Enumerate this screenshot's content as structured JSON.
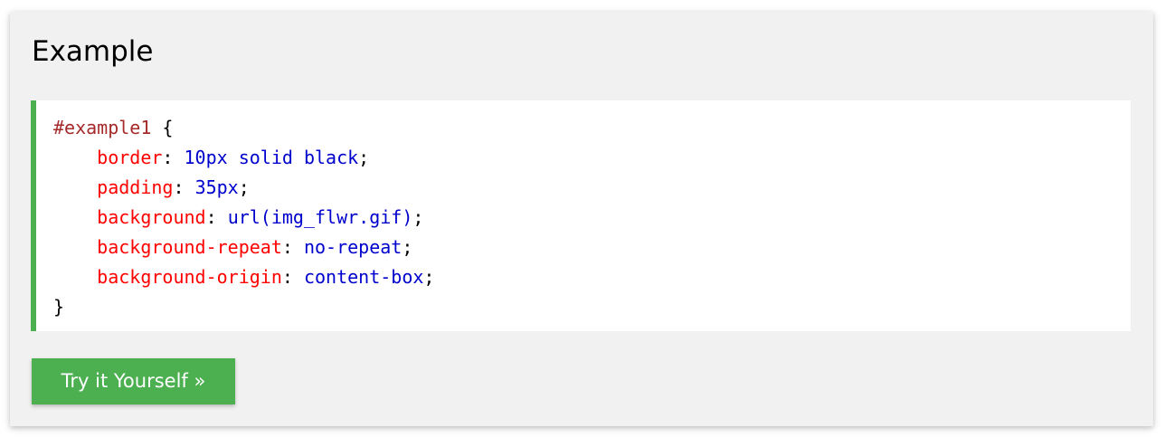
{
  "example": {
    "title": "Example",
    "code": {
      "selector": "#example1",
      "open_brace": " {",
      "close_brace": "}",
      "declarations": [
        {
          "property": "border",
          "value": "10px solid black"
        },
        {
          "property": "padding",
          "value": "35px"
        },
        {
          "property": "background",
          "value": "url(img_flwr.gif)"
        },
        {
          "property": "background-repeat",
          "value": "no-repeat"
        },
        {
          "property": "background-origin",
          "value": "content-box"
        }
      ]
    },
    "button_label": "Try it Yourself »"
  },
  "colors": {
    "card_background": "#f1f1f1",
    "accent_green": "#4caf50",
    "selector": "#a52a2a",
    "property": "#ff0000",
    "value": "#0000cd"
  }
}
